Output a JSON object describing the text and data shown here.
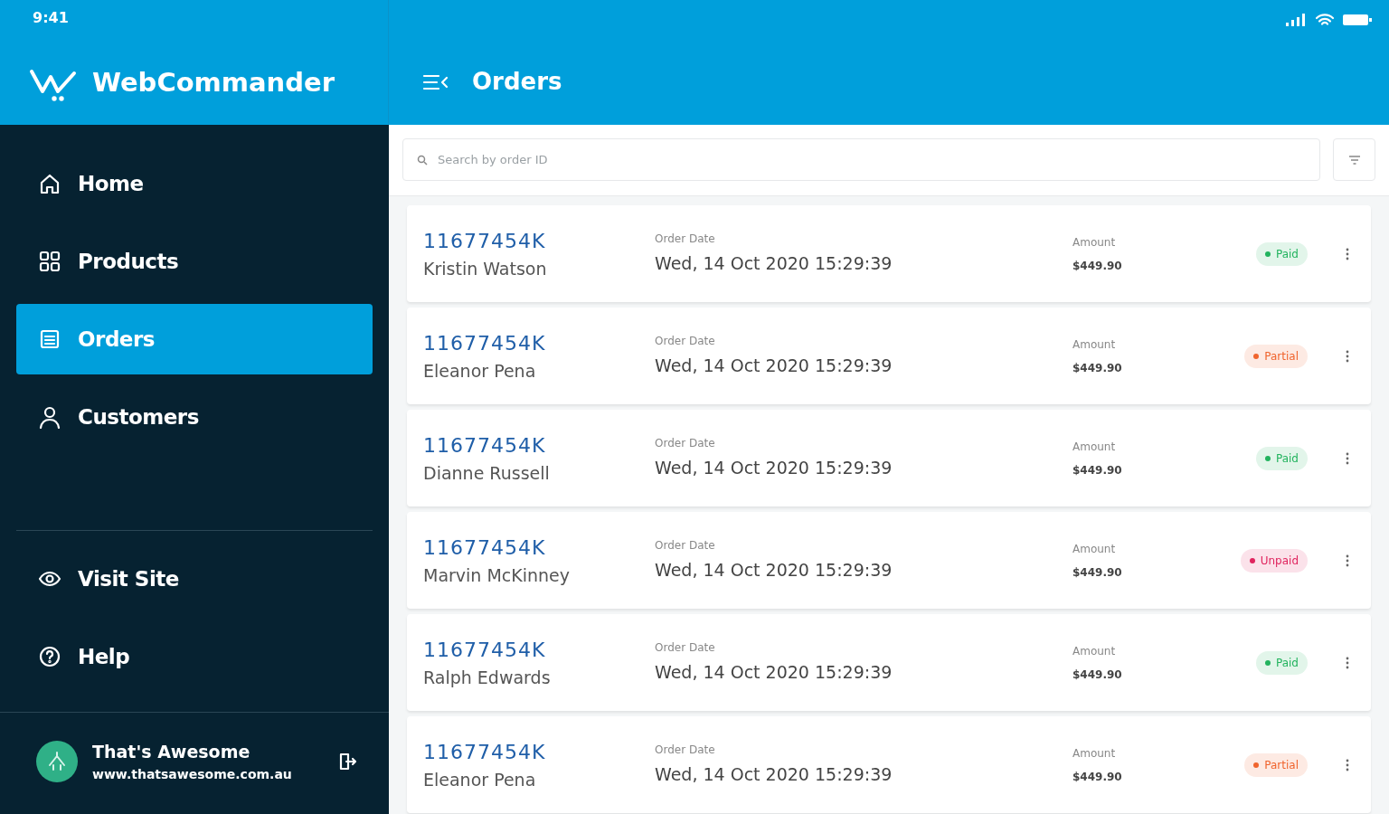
{
  "status_bar": {
    "time": "9:41"
  },
  "app": {
    "name": "WebCommander"
  },
  "header": {
    "title": "Orders"
  },
  "sidebar": {
    "items": [
      {
        "label": "Home",
        "selected": false
      },
      {
        "label": "Products",
        "selected": false
      },
      {
        "label": "Orders",
        "selected": true
      },
      {
        "label": "Customers",
        "selected": false
      }
    ],
    "bottom_items": [
      {
        "label": "Visit Site",
        "selected": false
      },
      {
        "label": "Help",
        "selected": false
      }
    ],
    "account": {
      "name": "That's Awesome",
      "url": "www.thatsawesome.com.au"
    }
  },
  "search": {
    "placeholder": "Search by order ID"
  },
  "orders": [
    {
      "id": "11677454K",
      "customer": "Kristin Watson",
      "date_label": "Order Date",
      "date": "Wed, 14 Oct 2020 15:29:39",
      "amount_label": "Amount",
      "amount": "$449.90",
      "status": "Paid",
      "color": "#22b35e"
    },
    {
      "id": "11677454K",
      "customer": "Eleanor Pena",
      "date_label": "Order Date",
      "date": "Wed, 14 Oct 2020 15:29:39",
      "amount_label": "Amount",
      "amount": "$449.90",
      "status": "Partial",
      "color": "#f0642d"
    },
    {
      "id": "11677454K",
      "customer": "Dianne Russell",
      "date_label": "Order Date",
      "date": "Wed, 14 Oct 2020 15:29:39",
      "amount_label": "Amount",
      "amount": "$449.90",
      "status": "Paid",
      "color": "#22b35e"
    },
    {
      "id": "11677454K",
      "customer": "Marvin McKinney",
      "date_label": "Order Date",
      "date": "Wed, 14 Oct 2020 15:29:39",
      "amount_label": "Amount",
      "amount": "$449.90",
      "status": "Unpaid",
      "color": "#e0245e"
    },
    {
      "id": "11677454K",
      "customer": "Ralph Edwards",
      "date_label": "Order Date",
      "date": "Wed, 14 Oct 2020 15:29:39",
      "amount_label": "Amount",
      "amount": "$449.90",
      "status": "Paid",
      "color": "#22b35e"
    },
    {
      "id": "11677454K",
      "customer": "Eleanor Pena",
      "date_label": "Order Date",
      "date": "Wed, 14 Oct 2020 15:29:39",
      "amount_label": "Amount",
      "amount": "$449.90",
      "status": "Partial",
      "color": "#f0642d"
    }
  ]
}
